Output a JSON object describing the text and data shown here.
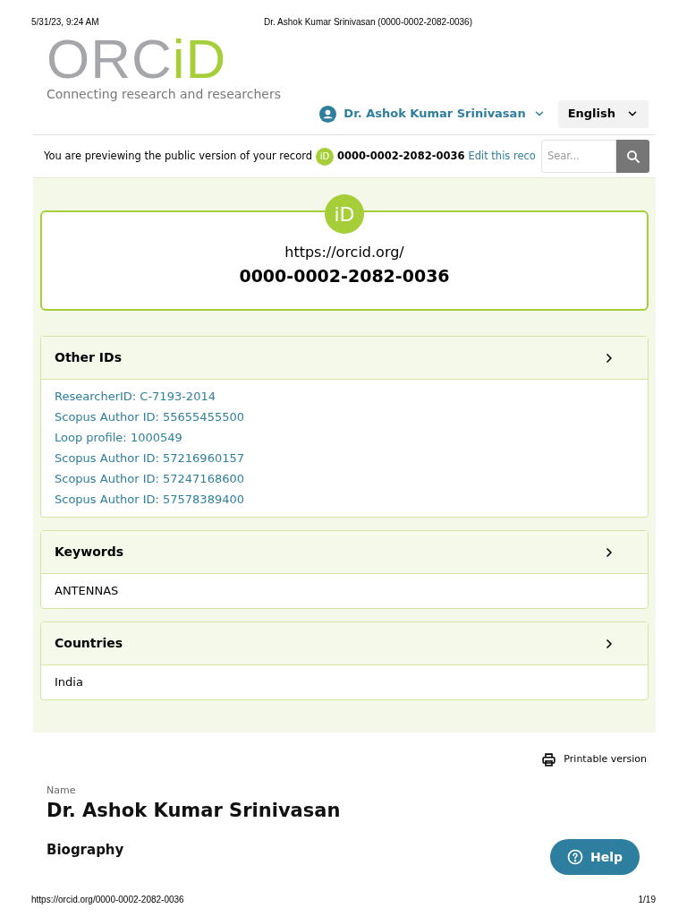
{
  "print_header": {
    "date": "5/31/23, 9:24 AM",
    "title": "Dr. Ashok Kumar Srinivasan (0000-0002-2082-0036)"
  },
  "logo": {
    "grey": "ORC",
    "green": "iD",
    "tagline": "Connecting research and researchers"
  },
  "user_menu": {
    "name": "Dr. Ashok Kumar Srinivasan"
  },
  "language": {
    "label": "English"
  },
  "banner": {
    "text": "You are previewing the public version of your record",
    "icon_text": "iD",
    "orcid": "0000-0002-2082-0036",
    "link": "Edit this reco",
    "search_placeholder": "Sear..."
  },
  "id_card": {
    "icon_text": "iD",
    "url": "https://orcid.org/",
    "orcid": "0000-0002-2082-0036"
  },
  "sections": [
    {
      "title": "Other IDs",
      "expanded": true,
      "kind": "links",
      "items": [
        "ResearcherID: C-7193-2014",
        "Scopus Author ID: 55655455500",
        "Loop profile: 1000549",
        "Scopus Author ID: 57216960157",
        "Scopus Author ID: 57247168600",
        "Scopus Author ID: 57578389400"
      ]
    },
    {
      "title": "Keywords",
      "expanded": true,
      "kind": "text",
      "items": [
        "ANTENNAS"
      ]
    },
    {
      "title": "Countries",
      "expanded": true,
      "kind": "text",
      "items": [
        "India"
      ]
    }
  ],
  "printable": {
    "label": "Printable version"
  },
  "name_block": {
    "label": "Name",
    "name": "Dr. Ashok Kumar Srinivasan",
    "next_heading": "Biography"
  },
  "help": {
    "label": "Help"
  },
  "print_footer": {
    "url": "https://orcid.org/0000-0002-2082-0036",
    "page": "1/19"
  }
}
